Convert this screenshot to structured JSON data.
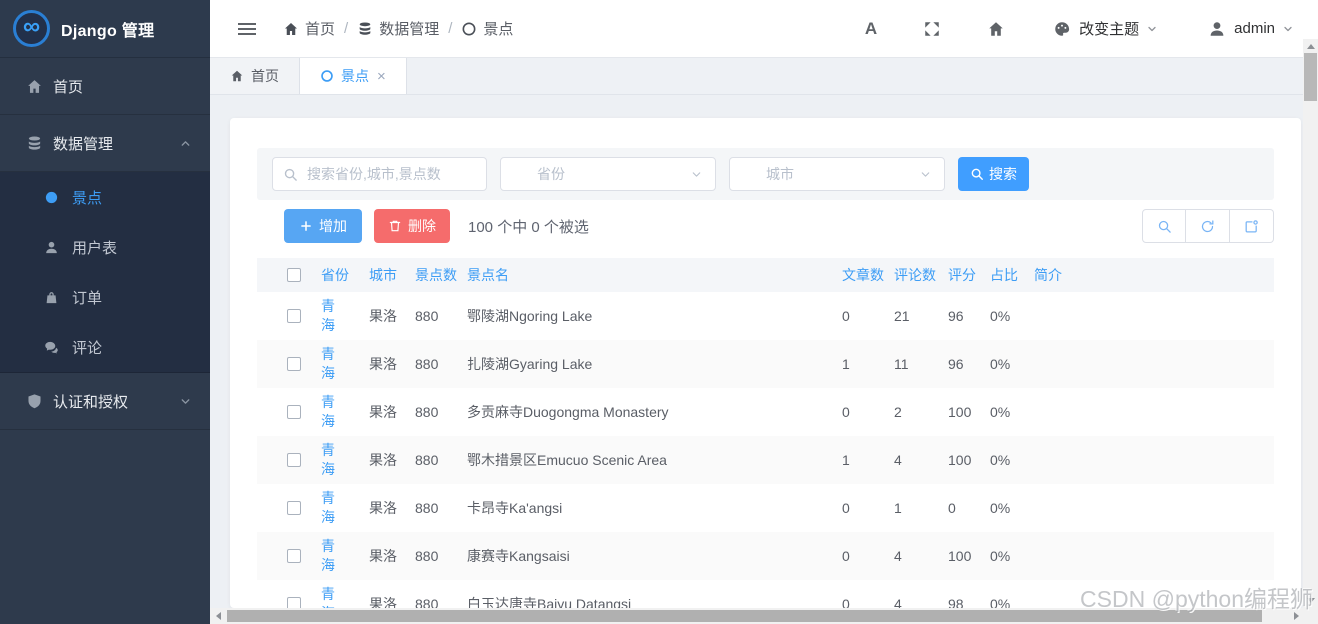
{
  "app": {
    "title": "Django 管理",
    "logo_symbol": "∞"
  },
  "sidebar": {
    "items": [
      {
        "label": "首页",
        "icon": "home-icon"
      },
      {
        "label": "数据管理",
        "icon": "database-icon",
        "expanded": true,
        "children": [
          {
            "label": "景点",
            "icon": "circle-icon",
            "active": true
          },
          {
            "label": "用户表",
            "icon": "user-icon"
          },
          {
            "label": "订单",
            "icon": "bag-icon"
          },
          {
            "label": "评论",
            "icon": "comments-icon"
          }
        ]
      },
      {
        "label": "认证和授权",
        "icon": "shield-icon",
        "expanded": false
      }
    ]
  },
  "topbar": {
    "separator": "/",
    "breadcrumb": [
      {
        "label": "首页",
        "icon": "home-icon"
      },
      {
        "label": "数据管理",
        "icon": "database-icon"
      },
      {
        "label": "景点",
        "icon": "circle-icon"
      }
    ],
    "language_label": "A",
    "theme_label": "改变主题",
    "username": "admin"
  },
  "tabs": [
    {
      "label": "首页",
      "icon": "home-icon",
      "active": false
    },
    {
      "label": "景点",
      "icon": "circle-icon",
      "active": true,
      "close": "×"
    }
  ],
  "filters": {
    "search_placeholder": "搜索省份,城市,景点数",
    "province_placeholder": "省份",
    "city_placeholder": "城市",
    "search_button": "搜索"
  },
  "toolbar": {
    "add_label": "增加",
    "delete_label": "删除",
    "selection_text": "100 个中 0 个被选"
  },
  "table": {
    "columns": [
      "省份",
      "城市",
      "景点数",
      "景点名",
      "文章数",
      "评论数",
      "评分",
      "占比",
      "简介"
    ],
    "rows": [
      {
        "province": "青海",
        "city": "果洛",
        "spot_count": "880",
        "name": "鄂陵湖Ngoring Lake",
        "articles": "0",
        "comments": "21",
        "score": "96",
        "ratio": "0%",
        "intro": ""
      },
      {
        "province": "青海",
        "city": "果洛",
        "spot_count": "880",
        "name": "扎陵湖Gyaring Lake",
        "articles": "1",
        "comments": "11",
        "score": "96",
        "ratio": "0%",
        "intro": ""
      },
      {
        "province": "青海",
        "city": "果洛",
        "spot_count": "880",
        "name": "多贡麻寺Duogongma Monastery",
        "articles": "0",
        "comments": "2",
        "score": "100",
        "ratio": "0%",
        "intro": ""
      },
      {
        "province": "青海",
        "city": "果洛",
        "spot_count": "880",
        "name": "鄂木措景区Emucuo Scenic Area",
        "articles": "1",
        "comments": "4",
        "score": "100",
        "ratio": "0%",
        "intro": ""
      },
      {
        "province": "青海",
        "city": "果洛",
        "spot_count": "880",
        "name": "卡昂寺Ka'angsi",
        "articles": "0",
        "comments": "1",
        "score": "0",
        "ratio": "0%",
        "intro": ""
      },
      {
        "province": "青海",
        "city": "果洛",
        "spot_count": "880",
        "name": "康赛寺Kangsaisi",
        "articles": "0",
        "comments": "4",
        "score": "100",
        "ratio": "0%",
        "intro": ""
      },
      {
        "province": "青海",
        "city": "果洛",
        "spot_count": "880",
        "name": "白玉达唐寺Baiyu Datangsi",
        "articles": "0",
        "comments": "4",
        "score": "98",
        "ratio": "0%",
        "intro": ""
      }
    ]
  },
  "watermark": "CSDN @python编程狮",
  "colors": {
    "primary": "#409eff",
    "danger": "#f56c6c",
    "link_blue": "#3d9df5",
    "sidebar_bg": "#2e3a4c",
    "sidebar_submenu_bg": "#232e42",
    "content_bg": "#edf0f4"
  }
}
